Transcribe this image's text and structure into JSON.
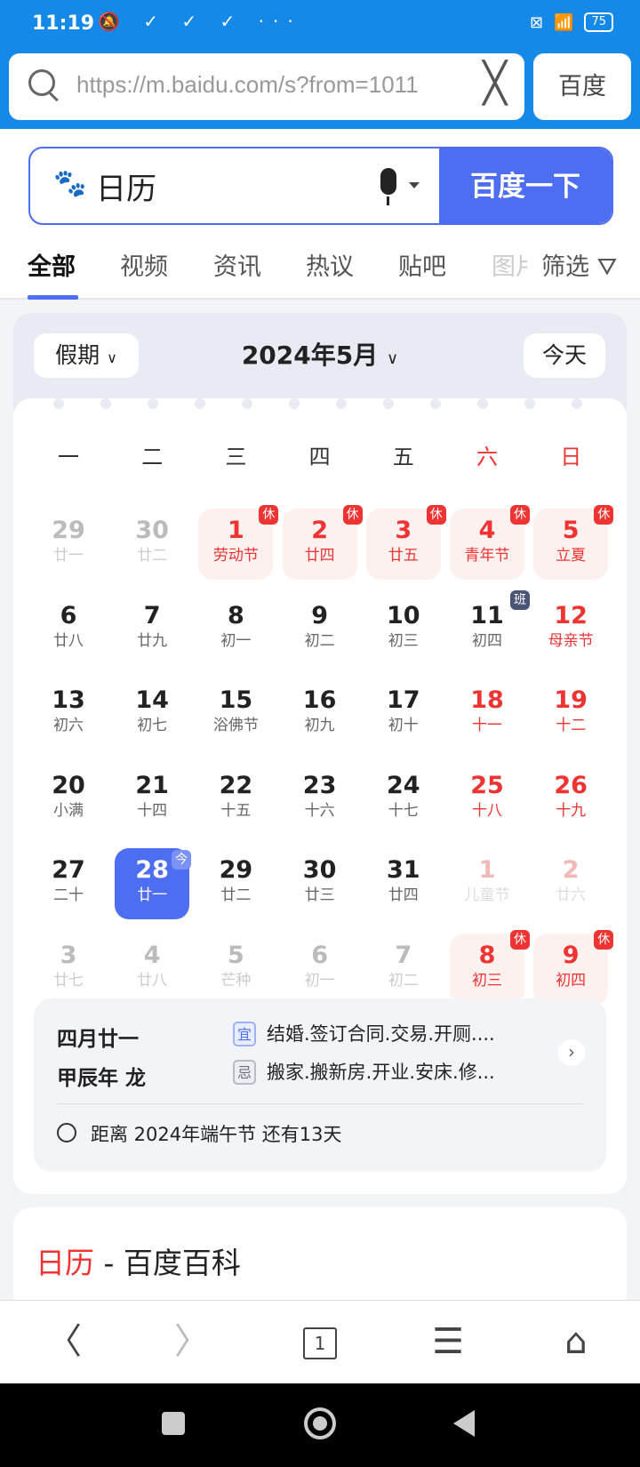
{
  "status_bar": {
    "time": "11:19",
    "icons": "🔕 ✓ ✓ ✓ ···",
    "battery": "75"
  },
  "url_bar": {
    "url": "https://m.baidu.com/s?from=1011",
    "home_button": "百度"
  },
  "search": {
    "query": "日历",
    "submit": "百度一下"
  },
  "tabs": [
    "全部",
    "视频",
    "资讯",
    "热议",
    "贴吧",
    "图片"
  ],
  "filter": "筛选",
  "calendar": {
    "holiday_select": "假期",
    "month": "2024年5月",
    "today_button": "今天",
    "weekdays": [
      "一",
      "二",
      "三",
      "四",
      "五",
      "六",
      "日"
    ],
    "days": [
      {
        "d": "29",
        "l": "廿一",
        "t": "muted"
      },
      {
        "d": "30",
        "l": "廿二",
        "t": "muted"
      },
      {
        "d": "1",
        "l": "劳动节",
        "t": "holiday",
        "b": "休"
      },
      {
        "d": "2",
        "l": "廿四",
        "t": "holiday",
        "b": "休"
      },
      {
        "d": "3",
        "l": "廿五",
        "t": "holiday",
        "b": "休"
      },
      {
        "d": "4",
        "l": "青年节",
        "t": "holiday",
        "b": "休"
      },
      {
        "d": "5",
        "l": "立夏",
        "t": "holiday",
        "b": "休"
      },
      {
        "d": "6",
        "l": "廿八",
        "t": "normal"
      },
      {
        "d": "7",
        "l": "廿九",
        "t": "normal"
      },
      {
        "d": "8",
        "l": "初一",
        "t": "normal"
      },
      {
        "d": "9",
        "l": "初二",
        "t": "normal"
      },
      {
        "d": "10",
        "l": "初三",
        "t": "normal"
      },
      {
        "d": "11",
        "l": "初四",
        "t": "normal",
        "b": "班"
      },
      {
        "d": "12",
        "l": "母亲节",
        "t": "red"
      },
      {
        "d": "13",
        "l": "初六",
        "t": "normal"
      },
      {
        "d": "14",
        "l": "初七",
        "t": "normal"
      },
      {
        "d": "15",
        "l": "浴佛节",
        "t": "normal"
      },
      {
        "d": "16",
        "l": "初九",
        "t": "normal"
      },
      {
        "d": "17",
        "l": "初十",
        "t": "normal"
      },
      {
        "d": "18",
        "l": "十一",
        "t": "red"
      },
      {
        "d": "19",
        "l": "十二",
        "t": "red"
      },
      {
        "d": "20",
        "l": "小满",
        "t": "normal"
      },
      {
        "d": "21",
        "l": "十四",
        "t": "normal"
      },
      {
        "d": "22",
        "l": "十五",
        "t": "normal"
      },
      {
        "d": "23",
        "l": "十六",
        "t": "normal"
      },
      {
        "d": "24",
        "l": "十七",
        "t": "normal"
      },
      {
        "d": "25",
        "l": "十八",
        "t": "red"
      },
      {
        "d": "26",
        "l": "十九",
        "t": "red"
      },
      {
        "d": "27",
        "l": "二十",
        "t": "normal"
      },
      {
        "d": "28",
        "l": "廿一",
        "t": "today",
        "b": "今"
      },
      {
        "d": "29",
        "l": "廿二",
        "t": "normal"
      },
      {
        "d": "30",
        "l": "廿三",
        "t": "normal"
      },
      {
        "d": "31",
        "l": "廿四",
        "t": "normal"
      },
      {
        "d": "1",
        "l": "儿童节",
        "t": "mutedred"
      },
      {
        "d": "2",
        "l": "廿六",
        "t": "mutedred"
      },
      {
        "d": "3",
        "l": "廿七",
        "t": "muted"
      },
      {
        "d": "4",
        "l": "廿八",
        "t": "muted"
      },
      {
        "d": "5",
        "l": "芒种",
        "t": "muted"
      },
      {
        "d": "6",
        "l": "初一",
        "t": "muted"
      },
      {
        "d": "7",
        "l": "初二",
        "t": "muted"
      },
      {
        "d": "8",
        "l": "初三",
        "t": "holiday",
        "b": "休"
      },
      {
        "d": "9",
        "l": "初四",
        "t": "holiday",
        "b": "休"
      }
    ],
    "info": {
      "lunar_date": "四月廿一",
      "lunar_year": "甲辰年 龙",
      "yi_label": "宜",
      "yi": "结婚.签订合同.交易.开厕....",
      "ji_label": "忌",
      "ji": "搬家.搬新房.开业.安床.修...",
      "countdown": "距离 2024年端午节 还有13天"
    }
  },
  "baike": {
    "keyword": "日历",
    "rest": " - 百度百科"
  },
  "bottom_nav": {
    "tab_count": "1"
  }
}
